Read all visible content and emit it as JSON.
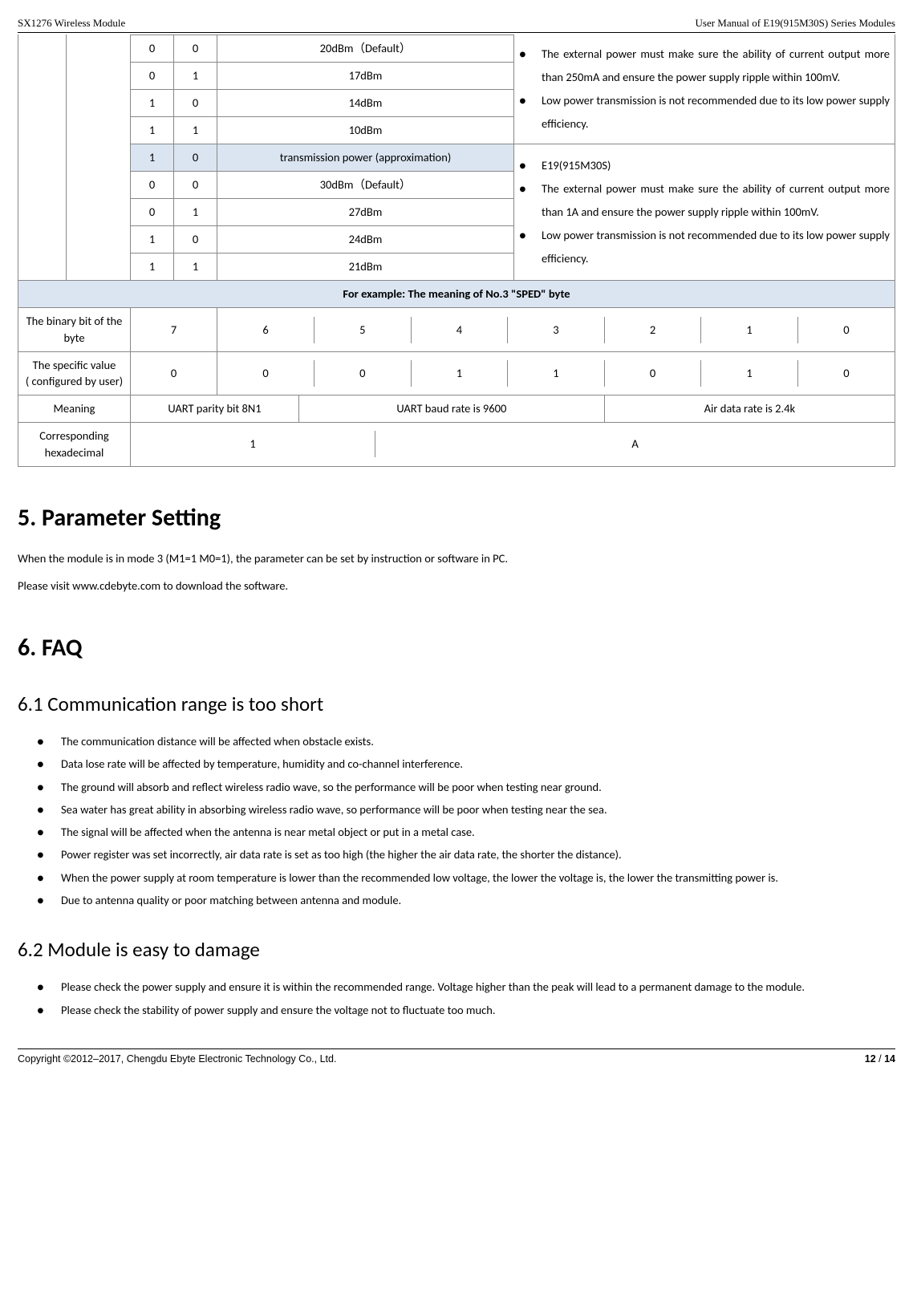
{
  "header": {
    "left": "SX1276 Wireless Module",
    "right": "User Manual of E19(915M30S) Series Modules"
  },
  "table1": {
    "rowsA": [
      {
        "b1": "0",
        "b2": "0",
        "desc": "20dBm（Default）"
      },
      {
        "b1": "0",
        "b2": "1",
        "desc": "17dBm"
      },
      {
        "b1": "1",
        "b2": "0",
        "desc": "14dBm"
      },
      {
        "b1": "1",
        "b2": "1",
        "desc": "10dBm"
      }
    ],
    "noteA": [
      "The external power must make sure the ability of current output more than 250mA and ensure the power supply ripple within 100mV.",
      "Low power transmission is not recommended due to its low power supply efficiency."
    ],
    "hdrRow": {
      "b1": "1",
      "b2": "0",
      "desc": "transmission power (approximation)"
    },
    "rowsB": [
      {
        "b1": "0",
        "b2": "0",
        "desc": "30dBm（Default）"
      },
      {
        "b1": "0",
        "b2": "1",
        "desc": "27dBm"
      },
      {
        "b1": "1",
        "b2": "0",
        "desc": "24dBm"
      },
      {
        "b1": "1",
        "b2": "1",
        "desc": "21dBm"
      }
    ],
    "noteB": [
      "E19(915M30S)",
      "The external power must make sure the ability of current output more than 1A and ensure the power supply ripple within 100mV.",
      "Low power transmission is not recommended due to its low power supply efficiency."
    ]
  },
  "example": {
    "title": "For example: The meaning of No.3 \"SPED\" byte",
    "row1_label": "The binary bit of the byte",
    "row1": [
      "7",
      "6",
      "5",
      "4",
      "3",
      "2",
      "1",
      "0"
    ],
    "row2_label_l1": "The specific value",
    "row2_label_l2": "( configured by user)",
    "row2": [
      "0",
      "0",
      "0",
      "1",
      "1",
      "0",
      "1",
      "0"
    ],
    "row3_label": "Meaning",
    "row3": [
      "UART parity bit 8N1",
      "UART baud rate is 9600",
      "Air data rate is 2.4k"
    ],
    "row4_label": "Corresponding hexadecimal",
    "row4": [
      "1",
      "A"
    ]
  },
  "s5": {
    "title": "5.  Parameter Setting",
    "p1": "When the module is in mode 3 (M1=1 M0=1), the parameter can be set by instruction or software in PC.",
    "p2": "Please visit www.cdebyte.com to download the software."
  },
  "s6": {
    "title": "6.  FAQ",
    "s61_title": "6.1 Communication range is too short",
    "s61_items": [
      "The communication distance will be affected when obstacle exists.",
      "Data lose rate will be affected by temperature, humidity and co-channel interference.",
      "The ground will absorb and reflect wireless radio wave, so the performance will be poor when testing near ground.",
      "Sea water has great ability in absorbing wireless radio wave, so performance will be poor when testing near the sea.",
      "The signal will be affected when the antenna is near metal object or put in a metal case.",
      "Power register was set incorrectly, air data rate is set as too high (the higher the air data rate, the shorter the distance).",
      "When the power supply at room temperature is lower than the recommended low voltage, the lower the voltage is, the lower the transmitting power is.",
      "Due to antenna quality or poor matching between antenna and module."
    ],
    "s62_title": "6.2 Module is easy to damage",
    "s62_items": [
      "Please check the power supply and ensure it is within the recommended range. Voltage higher than the peak will lead to a permanent damage to the module.",
      "Please check the stability of power supply and ensure the voltage not to fluctuate too much."
    ]
  },
  "footer": {
    "left": "Copyright ©2012–2017, Chengdu Ebyte Electronic Technology Co., Ltd.",
    "page_cur": "12",
    "page_sep": " / ",
    "page_total": "14"
  }
}
